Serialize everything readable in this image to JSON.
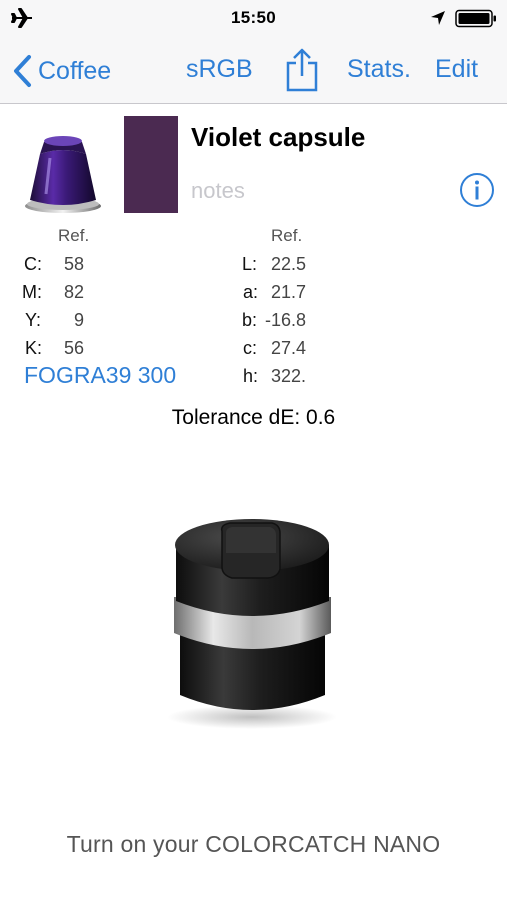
{
  "status_bar": {
    "time": "15:50",
    "icons": [
      "airplane-icon",
      "location-icon",
      "battery-icon"
    ]
  },
  "nav": {
    "back_label": "Coffee",
    "color_space": "sRGB",
    "share_icon": "share-icon",
    "stats_label": "Stats.",
    "edit_label": "Edit"
  },
  "sample": {
    "title": "Violet capsule",
    "notes_placeholder": "notes",
    "swatch_color": "#4b2a51",
    "capsule_image": "violet-coffee-capsule",
    "info_icon": "info-icon"
  },
  "cmyk": {
    "ref_header": "Ref.",
    "rows": [
      {
        "label": "C:",
        "value": "58"
      },
      {
        "label": "M:",
        "value": "82"
      },
      {
        "label": "Y:",
        "value": "9"
      },
      {
        "label": "K:",
        "value": "56"
      }
    ],
    "profile": "FOGRA39 300"
  },
  "lab": {
    "ref_header": "Ref.",
    "rows": [
      {
        "label": "L:",
        "value": "22.5"
      },
      {
        "label": "a:",
        "value": "21.7"
      },
      {
        "label": "b:",
        "value": "-16.8"
      },
      {
        "label": "c:",
        "value": "27.4"
      },
      {
        "label": "h:",
        "value": "322."
      }
    ]
  },
  "tolerance": "Tolerance dE: 0.6",
  "device_image": "colorcatch-nano-device",
  "footer_message": "Turn on your COLORCATCH NANO",
  "colors": {
    "accent": "#2f7fd6",
    "bar_bg": "#f7f7f8",
    "placeholder": "#c7c7cc"
  }
}
